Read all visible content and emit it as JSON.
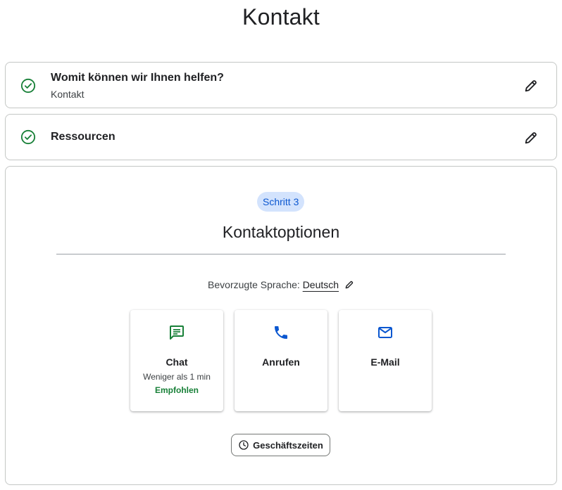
{
  "page": {
    "title": "Kontakt"
  },
  "steps": [
    {
      "title": "Womit können wir Ihnen helfen?",
      "subtitle": "Kontakt",
      "status_icon": "check-circle-icon",
      "edit_icon": "pencil-icon"
    },
    {
      "title": "Ressourcen",
      "status_icon": "check-circle-icon",
      "edit_icon": "pencil-icon"
    }
  ],
  "step3": {
    "badge": "Schritt 3",
    "title": "Kontaktoptionen",
    "language": {
      "label": "Bevorzugte Sprache:",
      "value": "Deutsch",
      "edit_icon": "pencil-icon"
    },
    "options": [
      {
        "label": "Chat",
        "sub": "Weniger als 1 min",
        "recommended": "Empfohlen",
        "icon": "chat-icon",
        "color": "#188038"
      },
      {
        "label": "Anrufen",
        "icon": "phone-icon",
        "color": "#0b57d0"
      },
      {
        "label": "E-Mail",
        "icon": "mail-icon",
        "color": "#0b57d0"
      }
    ],
    "hours_button": {
      "label": "Geschäftszeiten",
      "icon": "clock-icon"
    }
  },
  "colors": {
    "success": "#188038",
    "accent": "#0b57d0",
    "badge_bg": "#d3e3fd",
    "border": "#c4c7c5"
  }
}
